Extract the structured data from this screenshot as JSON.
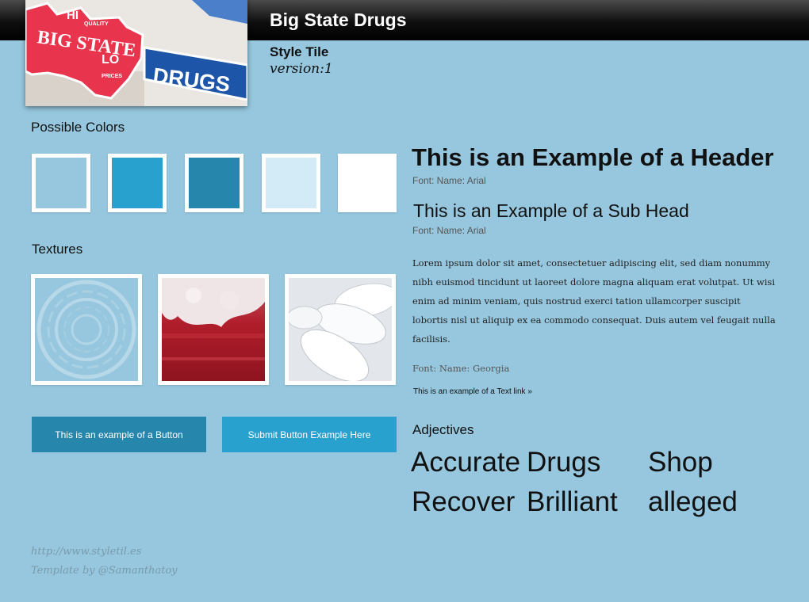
{
  "header": {
    "title": "Big State Drugs",
    "subtitle": "Style Tile",
    "version": "version:1"
  },
  "logo_sign": {
    "line1": "HI",
    "line1_small": "QUALITY",
    "line2": "BIG STATE",
    "line3": "LO",
    "line3_small": "PRICES",
    "drugs": "DRUGS"
  },
  "colors": {
    "label": "Possible Colors",
    "swatches": [
      "#96c7de",
      "#28a1cf",
      "#2686ac",
      "#d3ebf6",
      "#ffffff"
    ]
  },
  "textures": {
    "label": "Textures",
    "items": [
      "concentric-circles-texture",
      "red-liquid-texture",
      "white-pills-texture"
    ]
  },
  "buttons": {
    "primary": "This is an example of a Button",
    "submit": "Submit Button Example Here",
    "primary_color": "#2686ac",
    "submit_color": "#28a1cf"
  },
  "typography": {
    "header": "This is an Example of a Header",
    "header_font": "Font: Name: Arial",
    "subhead": "This is an Example of a Sub Head",
    "subhead_font": "Font: Name: Arial",
    "body": "Lorem ipsum dolor sit amet, consectetuer adipiscing elit, sed diam nonummy nibh euismod tincidunt ut laoreet dolore magna aliquam erat volutpat. Ut wisi enim ad minim veniam, quis nostrud exerci tation ullamcorper suscipit lobortis nisl ut aliquip ex ea commodo consequat. Duis autem vel feugait nulla facilisis.",
    "body_font": "Font: Name: Georgia",
    "text_link": "This is an example of a Text link »"
  },
  "adjectives": {
    "label": "Adjectives",
    "words": [
      "Accurate",
      "Drugs",
      "Shop",
      "Recover",
      "Brilliant",
      "alleged"
    ]
  },
  "footer": {
    "url": "http://www.styletil.es",
    "credit": "Template by @Samanthatoy"
  }
}
